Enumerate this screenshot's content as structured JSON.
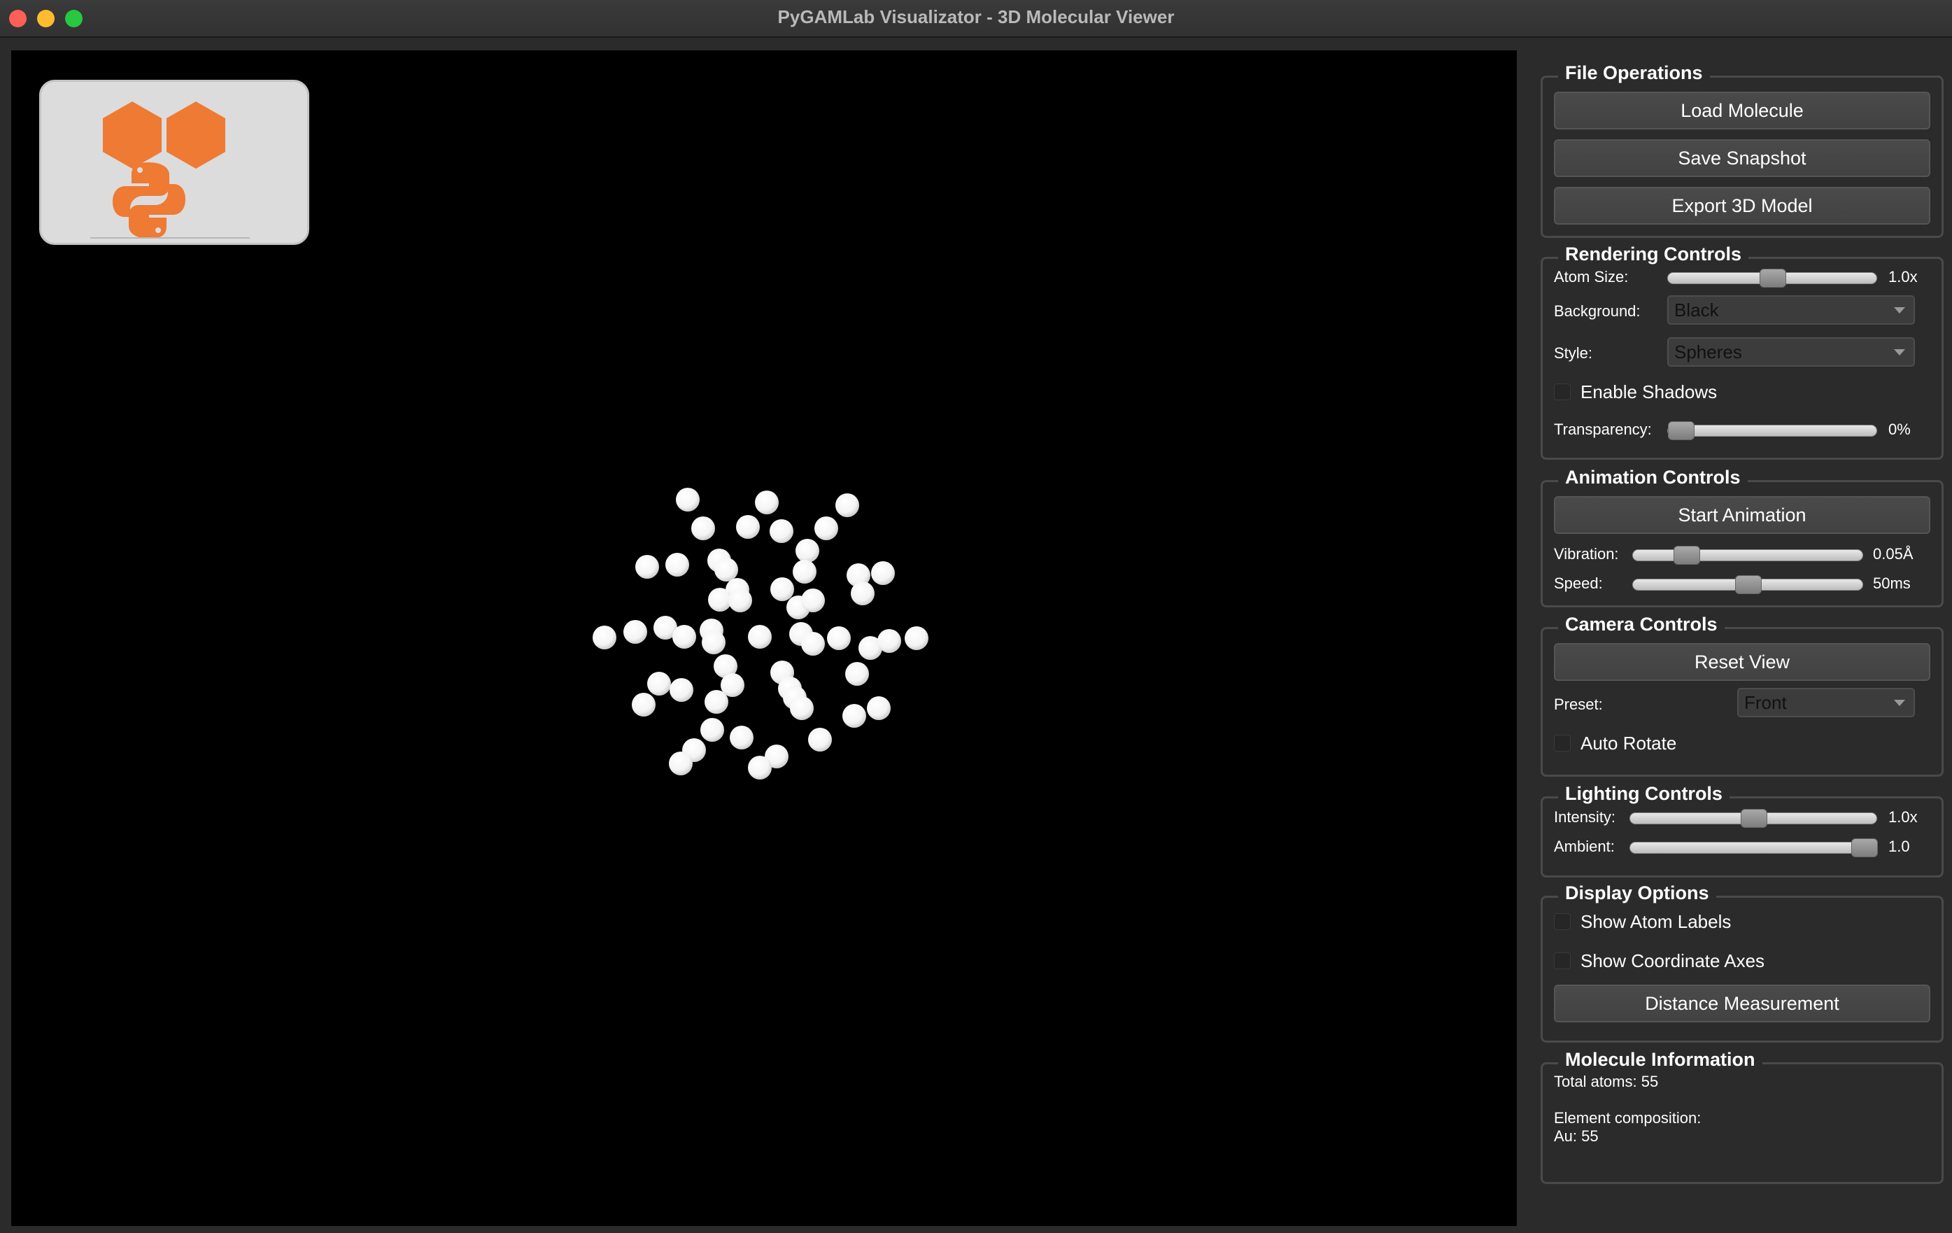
{
  "window": {
    "title": "PyGAMLab Visualizator - 3D Molecular Viewer"
  },
  "file_operations": {
    "title": "File Operations",
    "load_label": "Load Molecule",
    "save_label": "Save Snapshot",
    "export_label": "Export 3D Model"
  },
  "rendering": {
    "title": "Rendering Controls",
    "atom_size_label": "Atom Size:",
    "atom_size_value": "1.0x",
    "atom_size_level": 0.5,
    "background_label": "Background:",
    "background_value": "Black",
    "style_label": "Style:",
    "style_value": "Spheres",
    "shadows_label": "Enable Shadows",
    "shadows_checked": false,
    "transparency_label": "Transparency:",
    "transparency_value": "0%",
    "transparency_level": 0.0
  },
  "animation": {
    "title": "Animation Controls",
    "start_label": "Start Animation",
    "vibration_label": "Vibration:",
    "vibration_value": "0.05Å",
    "vibration_level": 0.2,
    "speed_label": "Speed:",
    "speed_value": "50ms",
    "speed_level": 0.5
  },
  "camera": {
    "title": "Camera Controls",
    "reset_label": "Reset View",
    "preset_label": "Preset:",
    "preset_value": "Front",
    "auto_rotate_label": "Auto Rotate",
    "auto_rotate_checked": false
  },
  "lighting": {
    "title": "Lighting Controls",
    "intensity_label": "Intensity:",
    "intensity_value": "1.0x",
    "intensity_level": 0.5,
    "ambient_label": "Ambient:",
    "ambient_value": "1.0",
    "ambient_level": 1.0
  },
  "display": {
    "title": "Display Options",
    "atom_labels_label": "Show Atom Labels",
    "atom_labels_checked": false,
    "axes_label": "Show Coordinate Axes",
    "axes_checked": false,
    "distance_label": "Distance Measurement"
  },
  "molecule_info": {
    "title": "Molecule Information",
    "total_atoms": "Total atoms: 55",
    "composition_label": "Element composition:",
    "composition_value": "Au: 55"
  },
  "colors": {
    "viewport_background": "#000000",
    "atom_color": "#ffffff",
    "logo_orange": "#ee7a33"
  },
  "icons": {
    "logo": "pygamlab-logo-icon"
  }
}
